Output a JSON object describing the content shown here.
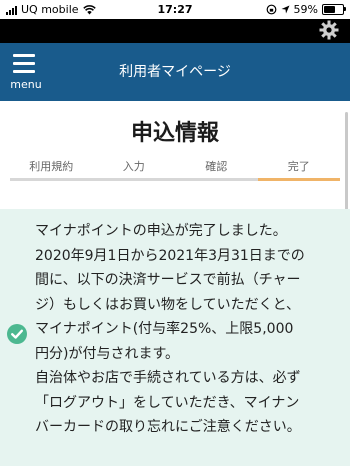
{
  "status_bar": {
    "carrier": "UQ mobile",
    "time": "17:27",
    "battery_percent": "59%",
    "battery_level": 0.59
  },
  "header": {
    "menu_label": "menu",
    "title": "利用者マイページ"
  },
  "page": {
    "title": "申込情報"
  },
  "steps": [
    {
      "label": "利用規約",
      "active": false
    },
    {
      "label": "入力",
      "active": false
    },
    {
      "label": "確認",
      "active": false
    },
    {
      "label": "完了",
      "active": true
    }
  ],
  "message": {
    "line1": "マイナポイントの申込が完了しました。",
    "line2": "2020年9月1日から2021年3月31日までの",
    "line3": "間に、以下の決済サービスで前払（チャー",
    "line4": "ジ）もしくはお買い物をしていただくと、",
    "line5": "マイナポイント(付与率25%、上限5,000",
    "line6": "円分)が付与されます。",
    "line7": "自治体やお店で手続されている方は、必ず",
    "line8": "「ログアウト」をしていただき、マイナン",
    "line9": "バーカードの取り忘れにご注意ください。"
  },
  "colors": {
    "header_bg": "#195b8c",
    "active_step": "#f0b468",
    "message_bg": "#e6f4f0",
    "check": "#4cb890"
  },
  "icons": {
    "gear": "gear-icon",
    "menu": "hamburger-menu-icon",
    "check": "check-circle-icon"
  }
}
